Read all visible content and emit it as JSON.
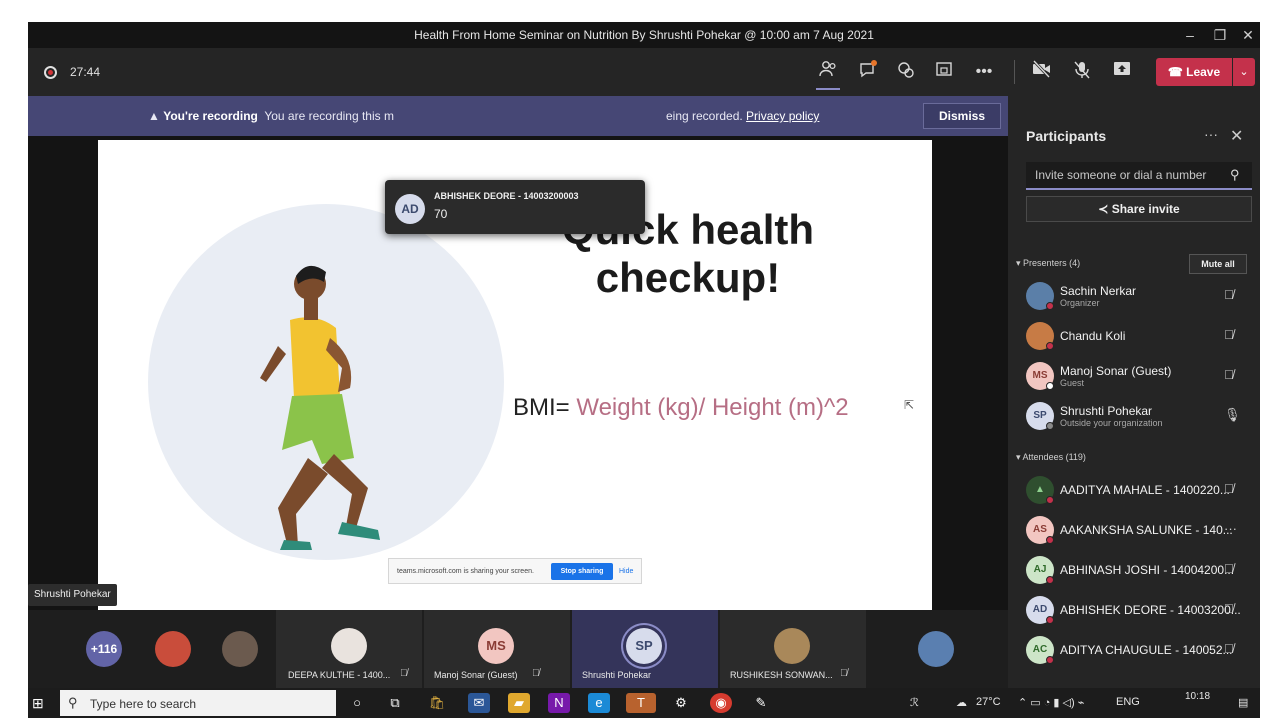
{
  "window": {
    "title": "Health From Home Seminar on Nutrition By Shrushti Pohekar @ 10:00 am 7 Aug 2021"
  },
  "toolbar": {
    "timer": "27:44",
    "leave_label": "Leave",
    "icons": [
      "people-icon",
      "chat-icon",
      "reactions-icon",
      "rooms-icon",
      "more-icon",
      "camera-off-icon",
      "mic-off-icon",
      "share-tray-icon",
      "phone-icon"
    ]
  },
  "banner": {
    "bold": "You're recording",
    "text_before": "You are recording this m",
    "text_after": "eing recorded.",
    "link": "Privacy policy",
    "dismiss": "Dismiss"
  },
  "toast": {
    "initials": "AD",
    "name": "ABHISHEK DEORE - 14003200003",
    "value": "70"
  },
  "slide": {
    "title": "Quick health checkup!",
    "bmi_prefix": "BMI=",
    "bmi_formula": "Weight (kg)/ Height (m)^2"
  },
  "share_bar": {
    "text": "teams.microsoft.com is sharing your screen.",
    "stop": "Stop sharing",
    "hide": "Hide"
  },
  "presenter_tag": "Shrushti Pohekar",
  "panel": {
    "title": "Participants",
    "invite_placeholder": "Invite someone or dial a number",
    "share_invite": "Share invite",
    "presenters_header": "Presenters (4)",
    "mute_all": "Mute all",
    "attendees_header": "Attendees (119)",
    "presenters": [
      {
        "initials": "",
        "name": "Sachin Nerkar",
        "sub": "Organizer",
        "color": "#5b7fa8"
      },
      {
        "initials": "",
        "name": "Chandu Koli",
        "sub": "",
        "color": "#c77b45"
      },
      {
        "initials": "MS",
        "name": "Manoj Sonar (Guest)",
        "sub": "Guest",
        "color": "#f2c6c1"
      },
      {
        "initials": "SP",
        "name": "Shrushti Pohekar",
        "sub": "Outside your organization",
        "color": "#d7dcec"
      }
    ],
    "attendees": [
      {
        "initials": "",
        "name": "AADITYA MAHALE - 1400220...",
        "color": "#3a6b3a"
      },
      {
        "initials": "AS",
        "name": "AAKANKSHA SALUNKE - 140...",
        "color": "#f2c6c1"
      },
      {
        "initials": "AJ",
        "name": "ABHINASH JOSHI - 14004200...",
        "color": "#cde5c8"
      },
      {
        "initials": "AD",
        "name": "ABHISHEK DEORE - 14003200...",
        "color": "#d7dcec"
      },
      {
        "initials": "AC",
        "name": "ADITYA CHAUGULE - 140052...",
        "color": "#cde5c8"
      }
    ]
  },
  "gallery": {
    "overflow": "+116",
    "tiles": [
      {
        "initials": "",
        "name": "DEEPA KULTHE - 1400..."
      },
      {
        "initials": "MS",
        "name": "Manoj Sonar (Guest)"
      },
      {
        "initials": "SP",
        "name": "Shrushti Pohekar"
      },
      {
        "initials": "",
        "name": "RUSHIKESH SONWAN..."
      }
    ]
  },
  "taskbar": {
    "search_placeholder": "Type here to search",
    "temperature": "27°C",
    "lang": "ENG",
    "time": "10:18"
  },
  "colors": {
    "accent": "#8b8cc7",
    "leave": "#c4314b",
    "banner": "#464775"
  }
}
